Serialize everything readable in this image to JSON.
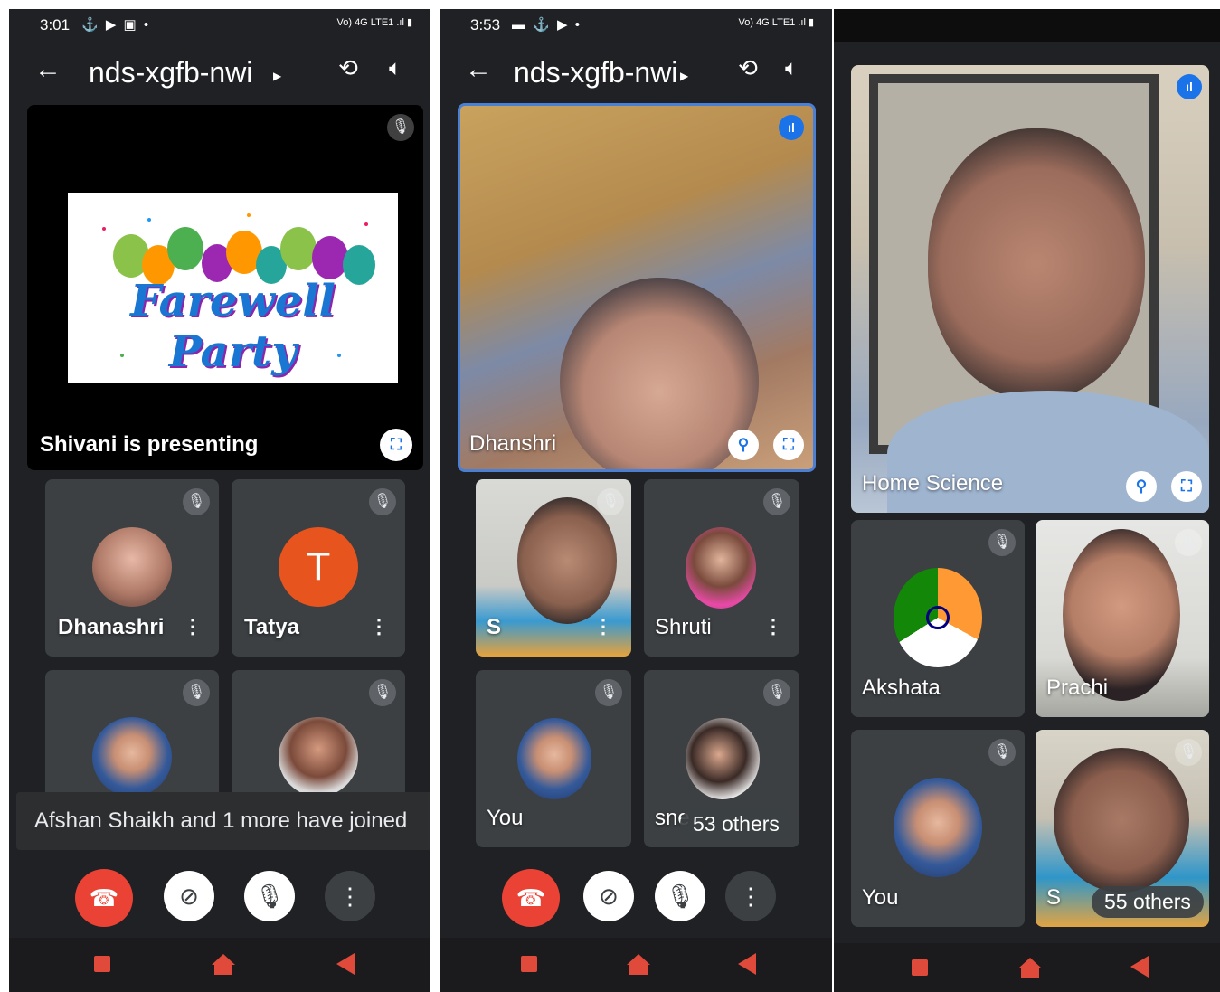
{
  "panel1": {
    "status": {
      "time": "3:01",
      "icons": "⚓ ▶ ▣ •",
      "right": "Vo) 4G LTE1 .ıl ▮"
    },
    "meeting_code": "nds-xgfb-nwi",
    "presentation": {
      "slide_title": "Farewell Party",
      "presenter_text": "Shivani is presenting"
    },
    "participants": [
      {
        "name": "Dhanashri",
        "avatar_letter": ""
      },
      {
        "name": "Tatya",
        "avatar_letter": "T"
      }
    ],
    "toast": "Afshan Shaikh and 1 more have joined"
  },
  "panel2": {
    "status": {
      "time": "3:53",
      "icons": "▬ ⚓ ▶ •",
      "right": "Vo) 4G LTE1 .ıl ▮"
    },
    "meeting_code": "nds-xgfb-nwi",
    "main_tile_name": "Dhanshri",
    "participants": [
      {
        "name": "S"
      },
      {
        "name": "Shruti"
      },
      {
        "name": "You"
      },
      {
        "name": "sne"
      }
    ],
    "others_badge": "53 others"
  },
  "panel3": {
    "main_tile_name": "Home Science",
    "participants": [
      {
        "name": "Akshata"
      },
      {
        "name": "Prachi"
      },
      {
        "name": "You"
      },
      {
        "name": "S"
      }
    ],
    "others_badge": "55 others"
  },
  "colors": {
    "end_call": "#ea4335",
    "accent": "#1a73e8",
    "background": "#202124",
    "tile": "#3c4043"
  },
  "icons": [
    "back-arrow-icon",
    "camera-flip-icon",
    "speaker-icon",
    "mic-off-icon",
    "fullscreen-icon",
    "pin-icon",
    "more-vert-icon",
    "end-call-icon",
    "camera-off-icon",
    "audio-level-icon"
  ]
}
